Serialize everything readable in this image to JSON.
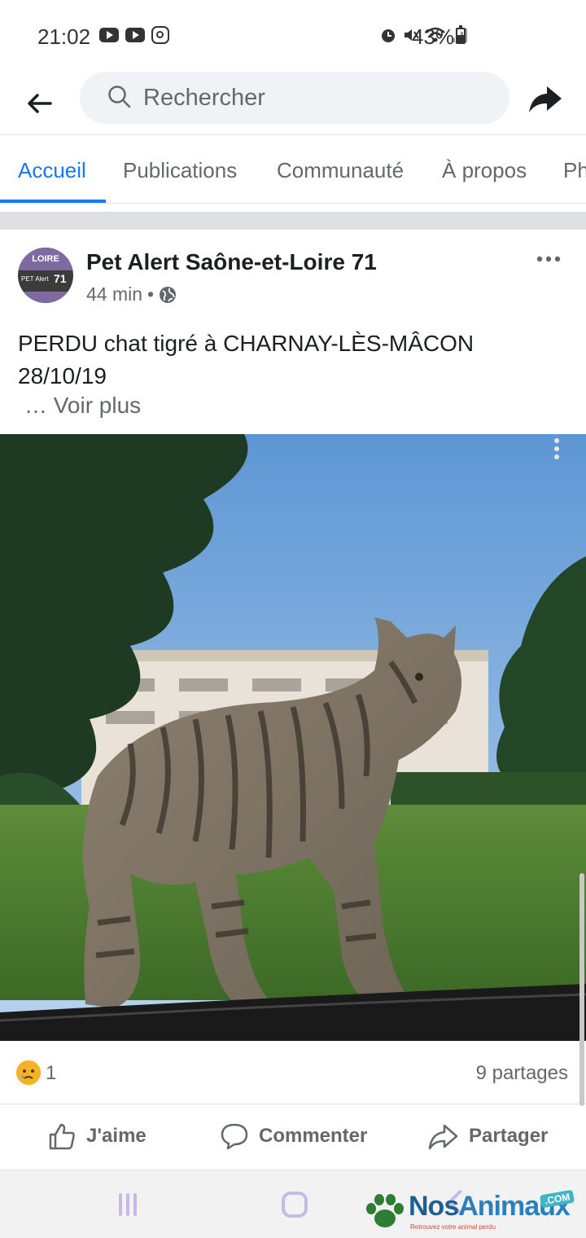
{
  "status_bar": {
    "time": "21:02",
    "battery": "43%",
    "icons": [
      "youtube-icon",
      "youtube-icon",
      "instagram-icon",
      "alarm-icon",
      "mute-icon",
      "wifi-icon",
      "signal-icon",
      "battery-icon"
    ]
  },
  "search": {
    "placeholder": "Rechercher"
  },
  "tabs": [
    {
      "label": "Accueil",
      "active": true
    },
    {
      "label": "Publications",
      "active": false
    },
    {
      "label": "Communauté",
      "active": false
    },
    {
      "label": "À propos",
      "active": false
    },
    {
      "label": "Ph",
      "active": false
    }
  ],
  "post": {
    "page_name": "Pet Alert Saône-et-Loire 71",
    "time_ago": "44 min",
    "privacy_icon": "globe-icon",
    "avatar": {
      "line1": "LOIRE",
      "brand": "PET Alert",
      "number": "71"
    },
    "text_line1": "PERDU chat tigré à CHARNAY-LÈS-MÂCON",
    "text_line2": "28/10/19",
    "see_more": "… Voir plus",
    "photo_subject": "tabby-cat-photo"
  },
  "reactions": {
    "emoji": "sad-reaction-icon",
    "count": "1",
    "shares": "9 partages"
  },
  "actions": {
    "like": "J'aime",
    "comment": "Commenter",
    "share": "Partager"
  },
  "watermark": {
    "brand_a": "Nos",
    "brand_b": "Animaux",
    "com": ".COM",
    "tagline": "Retrouvez votre animal perdu"
  },
  "colors": {
    "accent": "#1877f2",
    "text": "#1c1e21",
    "muted": "#65676b",
    "divider": "#dddfe2"
  }
}
